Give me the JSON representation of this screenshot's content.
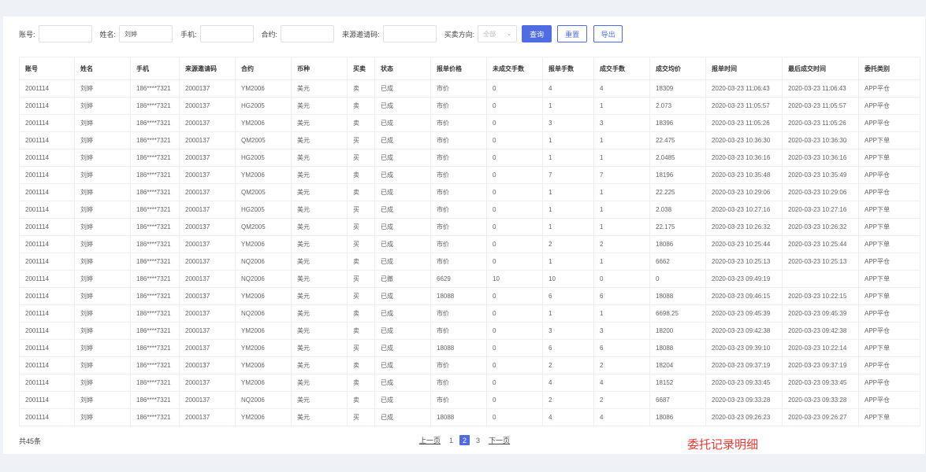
{
  "filters": {
    "account_label": "账号:",
    "name_label": "姓名:",
    "name_value": "刘婷",
    "phone_label": "手机:",
    "contract_label": "合约:",
    "invite_label": "来源邀请码:",
    "direction_label": "买卖方向:",
    "direction_value": "全部",
    "query_label": "查询",
    "reset_label": "重置",
    "export_label": "导出"
  },
  "table": {
    "headers": [
      "账号",
      "姓名",
      "手机",
      "来源邀请码",
      "合约",
      "币种",
      "买卖",
      "状态",
      "报单价格",
      "未成交手数",
      "报单手数",
      "成交手数",
      "成交均价",
      "报单时间",
      "最后成交时间",
      "委托类别"
    ],
    "rows": [
      [
        "2001114",
        "刘婷",
        "186****7321",
        "2000137",
        "YM2006",
        "美元",
        "卖",
        "已成",
        "市价",
        "0",
        "4",
        "4",
        "18309",
        "2020-03-23 11:06:43",
        "2020-03-23 11:06:43",
        "APP平仓"
      ],
      [
        "2001114",
        "刘婷",
        "186****7321",
        "2000137",
        "HG2005",
        "美元",
        "卖",
        "已成",
        "市价",
        "0",
        "1",
        "1",
        "2.073",
        "2020-03-23 11:05:57",
        "2020-03-23 11:05:57",
        "APP平仓"
      ],
      [
        "2001114",
        "刘婷",
        "186****7321",
        "2000137",
        "YM2006",
        "美元",
        "卖",
        "已成",
        "市价",
        "0",
        "3",
        "3",
        "18396",
        "2020-03-23 11:05:26",
        "2020-03-23 11:05:26",
        "APP平仓"
      ],
      [
        "2001114",
        "刘婷",
        "186****7321",
        "2000137",
        "QM2005",
        "美元",
        "买",
        "已成",
        "市价",
        "0",
        "1",
        "1",
        "22.475",
        "2020-03-23 10:36:30",
        "2020-03-23 10:36:30",
        "APP下单"
      ],
      [
        "2001114",
        "刘婷",
        "186****7321",
        "2000137",
        "HG2005",
        "美元",
        "买",
        "已成",
        "市价",
        "0",
        "1",
        "1",
        "2.0485",
        "2020-03-23 10:36:16",
        "2020-03-23 10:36:16",
        "APP下单"
      ],
      [
        "2001114",
        "刘婷",
        "186****7321",
        "2000137",
        "YM2006",
        "美元",
        "卖",
        "已成",
        "市价",
        "0",
        "7",
        "7",
        "18196",
        "2020-03-23 10:35:48",
        "2020-03-23 10:35:49",
        "APP平仓"
      ],
      [
        "2001114",
        "刘婷",
        "186****7321",
        "2000137",
        "QM2005",
        "美元",
        "卖",
        "已成",
        "市价",
        "0",
        "1",
        "1",
        "22.225",
        "2020-03-23 10:29:06",
        "2020-03-23 10:29:06",
        "APP平仓"
      ],
      [
        "2001114",
        "刘婷",
        "186****7321",
        "2000137",
        "HG2005",
        "美元",
        "买",
        "已成",
        "市价",
        "0",
        "1",
        "1",
        "2.038",
        "2020-03-23 10:27:16",
        "2020-03-23 10:27:16",
        "APP下单"
      ],
      [
        "2001114",
        "刘婷",
        "186****7321",
        "2000137",
        "QM2005",
        "美元",
        "买",
        "已成",
        "市价",
        "0",
        "1",
        "1",
        "22.175",
        "2020-03-23 10:26:32",
        "2020-03-23 10:26:32",
        "APP下单"
      ],
      [
        "2001114",
        "刘婷",
        "186****7321",
        "2000137",
        "YM2006",
        "美元",
        "买",
        "已成",
        "市价",
        "0",
        "2",
        "2",
        "18086",
        "2020-03-23 10:25:44",
        "2020-03-23 10:25:44",
        "APP下单"
      ],
      [
        "2001114",
        "刘婷",
        "186****7321",
        "2000137",
        "NQ2006",
        "美元",
        "卖",
        "已成",
        "市价",
        "0",
        "1",
        "1",
        "6662",
        "2020-03-23 10:25:13",
        "2020-03-23 10:25:13",
        "APP平仓"
      ],
      [
        "2001114",
        "刘婷",
        "186****7321",
        "2000137",
        "NQ2006",
        "美元",
        "买",
        "已撤",
        "6629",
        "10",
        "10",
        "0",
        "0",
        "2020-03-23 09:49:19",
        "",
        "APP下单"
      ],
      [
        "2001114",
        "刘婷",
        "186****7321",
        "2000137",
        "YM2006",
        "美元",
        "买",
        "已成",
        "18088",
        "0",
        "6",
        "6",
        "18088",
        "2020-03-23 09:46:15",
        "2020-03-23 10:22:15",
        "APP下单"
      ],
      [
        "2001114",
        "刘婷",
        "186****7321",
        "2000137",
        "NQ2006",
        "美元",
        "卖",
        "已成",
        "市价",
        "0",
        "1",
        "1",
        "6698.25",
        "2020-03-23 09:45:39",
        "2020-03-23 09:45:39",
        "APP平仓"
      ],
      [
        "2001114",
        "刘婷",
        "186****7321",
        "2000137",
        "YM2006",
        "美元",
        "卖",
        "已成",
        "市价",
        "0",
        "3",
        "3",
        "18200",
        "2020-03-23 09:42:38",
        "2020-03-23 09:42:38",
        "APP平仓"
      ],
      [
        "2001114",
        "刘婷",
        "186****7321",
        "2000137",
        "YM2006",
        "美元",
        "买",
        "已成",
        "18088",
        "0",
        "6",
        "6",
        "18088",
        "2020-03-23 09:39:10",
        "2020-03-23 10:22:14",
        "APP下单"
      ],
      [
        "2001114",
        "刘婷",
        "186****7321",
        "2000137",
        "YM2006",
        "美元",
        "卖",
        "已成",
        "市价",
        "0",
        "2",
        "2",
        "18204",
        "2020-03-23 09:37:19",
        "2020-03-23 09:37:19",
        "APP平仓"
      ],
      [
        "2001114",
        "刘婷",
        "186****7321",
        "2000137",
        "YM2006",
        "美元",
        "卖",
        "已成",
        "市价",
        "0",
        "4",
        "4",
        "18152",
        "2020-03-23 09:33:45",
        "2020-03-23 09:33:45",
        "APP平仓"
      ],
      [
        "2001114",
        "刘婷",
        "186****7321",
        "2000137",
        "NQ2006",
        "美元",
        "卖",
        "已成",
        "市价",
        "0",
        "2",
        "2",
        "6687",
        "2020-03-23 09:33:28",
        "2020-03-23 09:33:28",
        "APP平仓"
      ],
      [
        "2001114",
        "刘婷",
        "186****7321",
        "2000137",
        "YM2006",
        "美元",
        "买",
        "已成",
        "18088",
        "0",
        "4",
        "4",
        "18086",
        "2020-03-23 09:26:23",
        "2020-03-23 09:26:27",
        "APP下单"
      ]
    ]
  },
  "footer": {
    "total": "共45条",
    "prev": "上一页",
    "pages": [
      "1",
      "2",
      "3"
    ],
    "current_page": "2",
    "next": "下一页",
    "caption": "委托记录明细"
  },
  "colors": {
    "accent": "#4f6ce0",
    "caption": "#e8382f"
  }
}
